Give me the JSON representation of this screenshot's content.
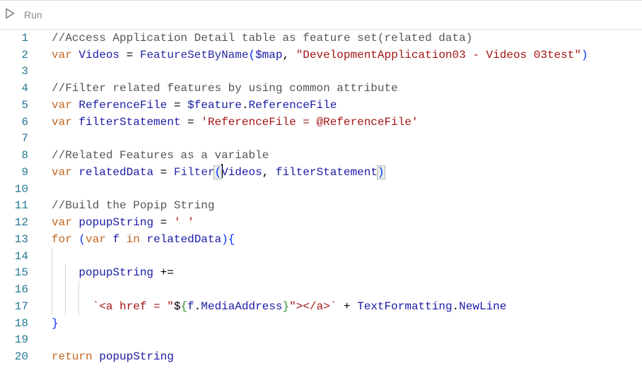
{
  "toolbar": {
    "run_label": "Run",
    "run_icon": "play-icon"
  },
  "colors": {
    "keyword": "#c2661f",
    "identifier": "#1a1aa6",
    "string": "#a31515",
    "comment": "#555555",
    "line_number": "#237893"
  },
  "editor": {
    "lines": [
      {
        "n": "1",
        "tokens": [
          [
            "//Access Application Detail table as feature set(related data)",
            "comment"
          ]
        ]
      },
      {
        "n": "2",
        "tokens": [
          [
            "var",
            "kw"
          ],
          [
            " ",
            "op"
          ],
          [
            "Videos",
            "id"
          ],
          [
            " = ",
            "op"
          ],
          [
            "FeatureSetByName",
            "fn"
          ],
          [
            "(",
            "paren"
          ],
          [
            "$map",
            "id"
          ],
          [
            ", ",
            "op"
          ],
          [
            "\"DevelopmentApplication03 - Videos 03test\"",
            "str"
          ],
          [
            ")",
            "paren"
          ]
        ]
      },
      {
        "n": "3",
        "tokens": []
      },
      {
        "n": "4",
        "tokens": [
          [
            "//Filter related features by using common attribute",
            "comment"
          ]
        ]
      },
      {
        "n": "5",
        "tokens": [
          [
            "var",
            "kw"
          ],
          [
            " ",
            "op"
          ],
          [
            "ReferenceFile",
            "id"
          ],
          [
            " = ",
            "op"
          ],
          [
            "$feature",
            "id"
          ],
          [
            ".",
            "op"
          ],
          [
            "ReferenceFile",
            "id"
          ]
        ]
      },
      {
        "n": "6",
        "tokens": [
          [
            "var",
            "kw"
          ],
          [
            " ",
            "op"
          ],
          [
            "filterStatement",
            "id"
          ],
          [
            " = ",
            "op"
          ],
          [
            "'ReferenceFile = @ReferenceFile'",
            "str"
          ]
        ]
      },
      {
        "n": "7",
        "tokens": []
      },
      {
        "n": "8",
        "tokens": [
          [
            "//Related Features as a variable",
            "comment"
          ]
        ]
      },
      {
        "n": "9",
        "tokens": [
          [
            "var",
            "kw"
          ],
          [
            " ",
            "op"
          ],
          [
            "relatedData",
            "id"
          ],
          [
            " = ",
            "op"
          ],
          [
            "Filter",
            "fn"
          ],
          [
            "(",
            "paren bm cursor"
          ],
          [
            "Videos",
            "id"
          ],
          [
            ", ",
            "op"
          ],
          [
            "filterStatement",
            "id"
          ],
          [
            ")",
            "paren bm"
          ]
        ]
      },
      {
        "n": "10",
        "tokens": []
      },
      {
        "n": "11",
        "tokens": [
          [
            "//Build the Popip String",
            "comment"
          ]
        ]
      },
      {
        "n": "12",
        "tokens": [
          [
            "var",
            "kw"
          ],
          [
            " ",
            "op"
          ],
          [
            "popupString",
            "id"
          ],
          [
            " = ",
            "op"
          ],
          [
            "' '",
            "str"
          ]
        ]
      },
      {
        "n": "13",
        "tokens": [
          [
            "for",
            "kw"
          ],
          [
            " ",
            "op"
          ],
          [
            "(",
            "paren"
          ],
          [
            "var",
            "kw"
          ],
          [
            " ",
            "op"
          ],
          [
            "f",
            "id"
          ],
          [
            " ",
            "op"
          ],
          [
            "in",
            "kw"
          ],
          [
            " ",
            "op"
          ],
          [
            "relatedData",
            "id"
          ],
          [
            ")",
            "paren"
          ],
          [
            "{",
            "paren"
          ]
        ]
      },
      {
        "n": "14",
        "tokens": [],
        "guides": 1
      },
      {
        "n": "15",
        "tokens": [
          [
            "    ",
            "op"
          ],
          [
            "popupString",
            "id"
          ],
          [
            " += ",
            "op"
          ]
        ],
        "guides": 2
      },
      {
        "n": "16",
        "tokens": [],
        "guides": 3
      },
      {
        "n": "17",
        "tokens": [
          [
            "      ",
            "op"
          ],
          [
            "`<a href = \"",
            "str"
          ],
          [
            "$",
            "op"
          ],
          [
            "{",
            "brace"
          ],
          [
            "f",
            "id"
          ],
          [
            ".",
            "op"
          ],
          [
            "MediaAddress",
            "id"
          ],
          [
            "}",
            "brace"
          ],
          [
            "\"></a>`",
            "str"
          ],
          [
            " + ",
            "op"
          ],
          [
            "TextFormatting",
            "id"
          ],
          [
            ".",
            "op"
          ],
          [
            "NewLine",
            "id"
          ]
        ],
        "guides": 3
      },
      {
        "n": "18",
        "tokens": [
          [
            "}",
            "paren"
          ]
        ]
      },
      {
        "n": "19",
        "tokens": []
      },
      {
        "n": "20",
        "tokens": [
          [
            "return",
            "kw"
          ],
          [
            " ",
            "op"
          ],
          [
            "popupString",
            "id"
          ]
        ]
      }
    ]
  }
}
